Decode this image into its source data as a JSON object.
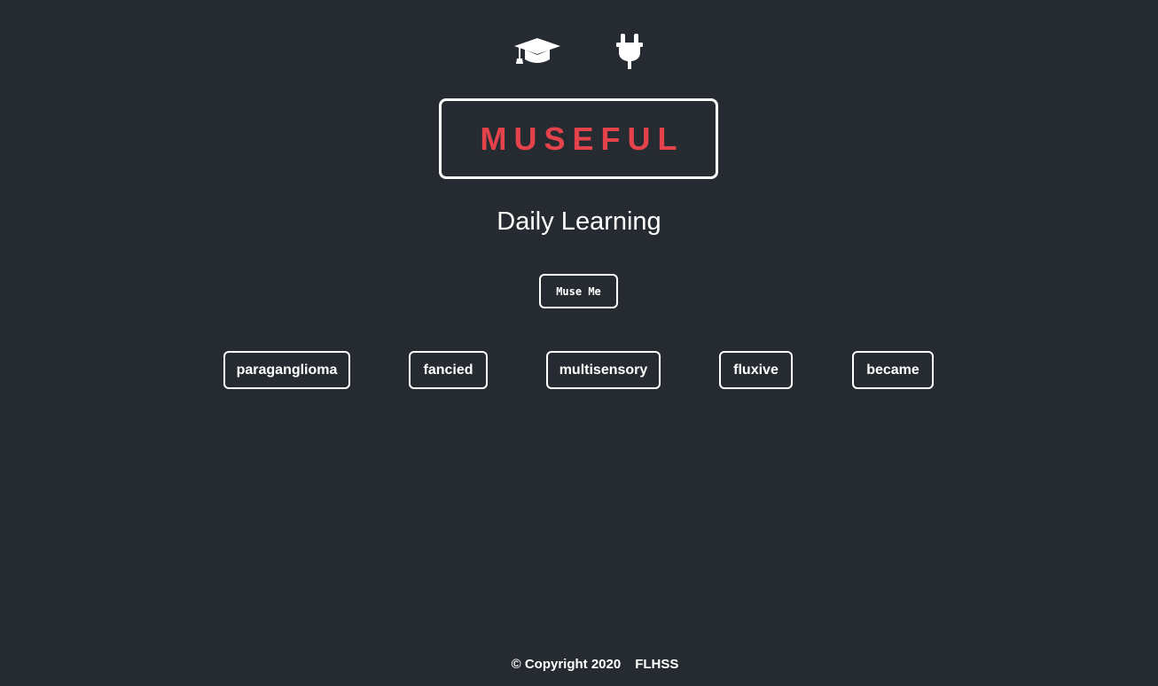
{
  "header": {
    "icons": [
      {
        "name": "graduation-cap-icon",
        "label": "Learn"
      },
      {
        "name": "plug-icon",
        "label": "Connect"
      }
    ]
  },
  "logo": {
    "text": "MUSEFUL"
  },
  "subtitle": "Daily Learning",
  "action": {
    "label": "Muse Me"
  },
  "words": [
    "paraganglioma",
    "fancied",
    "multisensory",
    "fluxive",
    "became"
  ],
  "footer": {
    "copyright": "© Copyright 2020",
    "org": "FLHSS"
  },
  "colors": {
    "background": "#262a31",
    "accent": "#e4434b",
    "foreground": "#ffffff"
  }
}
